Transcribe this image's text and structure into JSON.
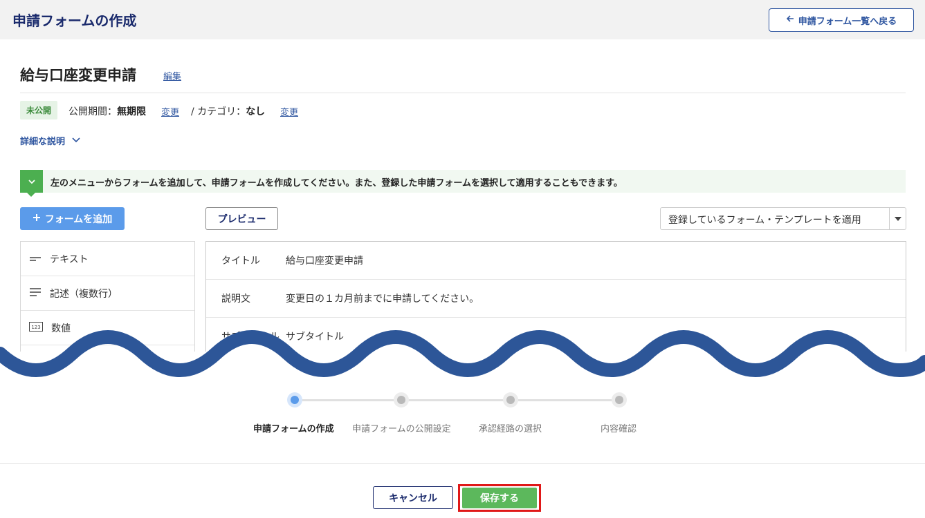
{
  "header": {
    "title": "申請フォームの作成",
    "back_label": "申請フォーム一覧へ戻る"
  },
  "form": {
    "name": "給与口座変更申請",
    "edit_label": "編集",
    "status_badge": "未公開",
    "period_label": "公開期間：",
    "period_value": "無期限",
    "change_label": "変更",
    "category_label": "/ カテゴリ：",
    "category_value": "なし",
    "detail_label": "詳細な説明"
  },
  "notice": {
    "text": "左のメニューからフォームを追加して、申請フォームを作成してください。また、登録した申請フォームを選択して適用することもできます。"
  },
  "toolbar": {
    "add_label": "フォームを追加",
    "preview_label": "プレビュー",
    "apply_label": "登録しているフォーム・テンプレートを適用"
  },
  "menu": {
    "items": [
      {
        "label": "テキスト",
        "icon": "short-text-icon"
      },
      {
        "label": "記述（複数行）",
        "icon": "multiline-text-icon"
      },
      {
        "label": "数値",
        "icon": "number-icon"
      }
    ]
  },
  "fields": [
    {
      "key": "タイトル",
      "value": "給与口座変更申請"
    },
    {
      "key": "説明文",
      "value": "変更日の１カ月前までに申請してください。"
    },
    {
      "key": "サブタイトル",
      "value": "サブタイトル"
    }
  ],
  "steps": [
    {
      "label": "申請フォームの作成",
      "active": true
    },
    {
      "label": "申請フォームの公開設定",
      "active": false
    },
    {
      "label": "承認経路の選択",
      "active": false
    },
    {
      "label": "内容確認",
      "active": false
    }
  ],
  "footer": {
    "cancel_label": "キャンセル",
    "save_label": "保存する"
  },
  "colors": {
    "accent": "#2f56a0",
    "wave": "#2d5698",
    "save": "#5cb85c",
    "highlight": "#e01818"
  }
}
